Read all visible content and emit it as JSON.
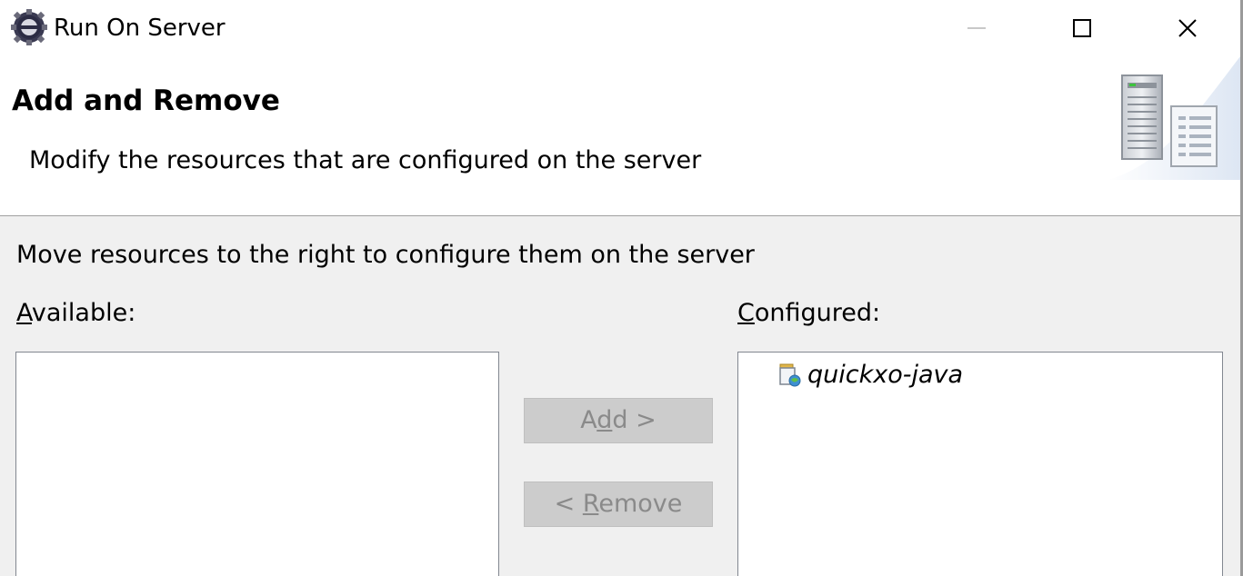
{
  "window": {
    "title": "Run On Server"
  },
  "banner": {
    "title": "Add and Remove",
    "description": "Modify the resources that are configured on the server"
  },
  "content": {
    "instruction": "Move resources to the right to configure them on the server",
    "available": {
      "mnemonic": "A",
      "rest": "vailable:",
      "items": []
    },
    "configured": {
      "mnemonic": "C",
      "rest": "onfigured:",
      "items": [
        {
          "label": "quickxo-java",
          "icon": "web-module-icon"
        }
      ]
    },
    "buttons": {
      "add": {
        "pre": "A",
        "mnemonic": "d",
        "post": "d >",
        "enabled": false
      },
      "remove": {
        "pre": "< ",
        "mnemonic": "R",
        "post": "emove",
        "enabled": false
      }
    }
  },
  "colors": {
    "content_bg": "#f0f0f0",
    "disabled_button_bg": "#cccccc",
    "disabled_text": "#8a8a8a",
    "list_border": "#828790"
  }
}
